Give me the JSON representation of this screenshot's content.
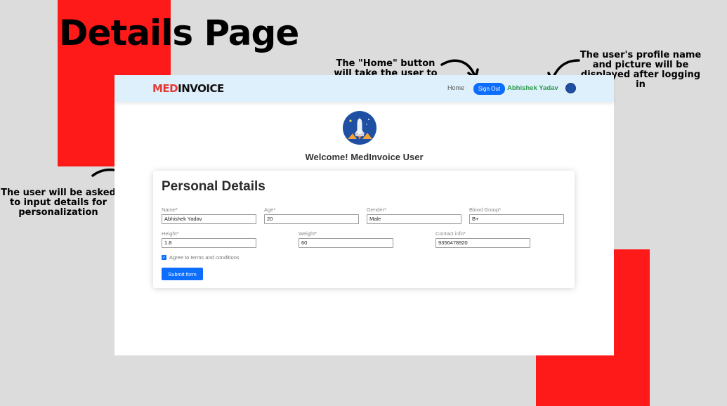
{
  "page": {
    "heading": "Details Page"
  },
  "annotations": {
    "home_note": "The \"Home\" button will take the user to the landing/home page",
    "profile_note": "The user's profile name and picture will be displayed after logging in",
    "input_note": "The user will be asked to input details for personalization"
  },
  "navbar": {
    "logo_prefix": "MED",
    "logo_suffix": "INVOICE",
    "home_label": "Home",
    "signout_label": "Sign Out",
    "user_name": "Abhishek Yadav"
  },
  "welcome": "Welcome! MedInvoice User",
  "form": {
    "title": "Personal Details",
    "name": {
      "label": "Name*",
      "value": "Abhishek Yadav"
    },
    "age": {
      "label": "Age*",
      "value": "20"
    },
    "gender": {
      "label": "Gender*",
      "value": "Male"
    },
    "blood_group": {
      "label": "Blood Group*",
      "value": "B+"
    },
    "height": {
      "label": "Height*",
      "value": "1.8"
    },
    "weight": {
      "label": "Weight*",
      "value": "60"
    },
    "contact": {
      "label": "Contact info*",
      "value": "9356478920"
    },
    "terms_label": "Agree to terms and conditions",
    "terms_checked": true,
    "submit_label": "Submit form"
  },
  "colors": {
    "accent": "#0d6efd",
    "brand_red": "#ff1a1a",
    "navbar_bg": "#dff0fd",
    "user_name": "#2e9b4f"
  }
}
